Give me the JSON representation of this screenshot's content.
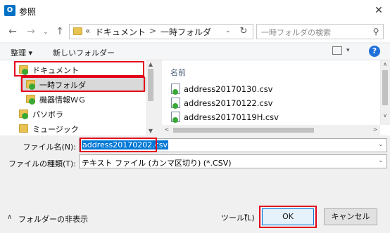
{
  "window": {
    "title": "参照",
    "app_icon": "outlook-icon"
  },
  "nav": {
    "breadcrumb_prefix": "«",
    "breadcrumb": [
      "ドキュメント",
      "一時フォルダ"
    ],
    "separator": ">",
    "search_placeholder": "一時フォルダの検索"
  },
  "toolbar": {
    "organize": "整理 ▾",
    "new_folder": "新しいフォルダー"
  },
  "tree": {
    "items": [
      {
        "label": "ドキュメント"
      },
      {
        "label": "一時フォルダ"
      },
      {
        "label": "機器情報ＷＧ"
      },
      {
        "label": "パソボラ"
      },
      {
        "label": "ミュージック"
      }
    ]
  },
  "filelist": {
    "column_header": "名前",
    "files": [
      {
        "name": "address20170130.csv"
      },
      {
        "name": "address20170122.csv"
      },
      {
        "name": "address20170119H.csv"
      }
    ]
  },
  "bottom": {
    "filename_label": "ファイル名(N):",
    "filename_value": "address20170202.csv",
    "filetype_label": "ファイルの種類(T):",
    "filetype_value": "テキスト ファイル (カンマ区切り) (*.CSV)",
    "hide_folders": "フォルダーの非表示",
    "tools": "ツール(L)",
    "ok": "OK",
    "cancel": "キャンセル"
  },
  "colors": {
    "highlight_box": "#e3001b",
    "selection": "#0078d7",
    "folder": "#e8c252"
  }
}
